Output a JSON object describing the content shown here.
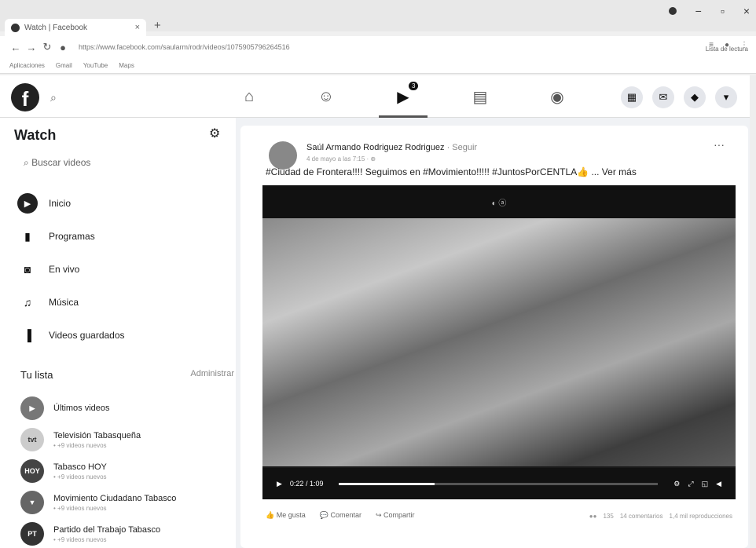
{
  "browser": {
    "tab_title": "Watch | Facebook",
    "tab_close": "×",
    "new_tab": "+",
    "url": "https://www.facebook.com/saularm/rodr/videos/1075905796264516",
    "reading_list": "Lista de lectura",
    "bookmarks": [
      "Aplicaciones",
      "Gmail",
      "YouTube",
      "Maps"
    ]
  },
  "fb": {
    "logo": "f",
    "badge": "3",
    "nav_icons": [
      "home-icon",
      "friends-icon",
      "watch-icon",
      "marketplace-icon",
      "groups-icon"
    ]
  },
  "sidebar": {
    "title": "Watch",
    "search_placeholder": "Buscar videos",
    "menu": [
      {
        "label": "Inicio",
        "icon": "play-circle-icon"
      },
      {
        "label": "Programas",
        "icon": "programs-icon"
      },
      {
        "label": "En vivo",
        "icon": "live-icon"
      },
      {
        "label": "Música",
        "icon": "music-icon"
      },
      {
        "label": "Videos guardados",
        "icon": "bookmark-icon"
      }
    ],
    "list_title": "Tu lista",
    "admin": "Administrar",
    "list": [
      {
        "name": "Últimos videos",
        "sub": ""
      },
      {
        "name": "Televisión Tabasqueña",
        "sub": "• +9 videos nuevos"
      },
      {
        "name": "Tabasco HOY",
        "sub": "• +9 videos nuevos"
      },
      {
        "name": "Movimiento Ciudadano Tabasco",
        "sub": "• +9 videos nuevos"
      },
      {
        "name": "Partido del Trabajo Tabasco",
        "sub": "• +9 videos nuevos"
      }
    ]
  },
  "post": {
    "author": "Saúl Armando Rodriguez Rodriguez",
    "follow": "· Seguir",
    "date": "4 de mayo a las 7:15 ·",
    "text": "#Ciudad de Frontera!!!! Seguimos en #Movimiento!!!!! #JuntosPorCENTLA👍 ... Ver más",
    "time": "0:22 / 1:09",
    "progress": 0.3,
    "actions": [
      "Me gusta",
      "Comentar",
      "Compartir"
    ],
    "stats": [
      "135",
      "14 comentarios",
      "1,4 mil reproducciones"
    ]
  }
}
